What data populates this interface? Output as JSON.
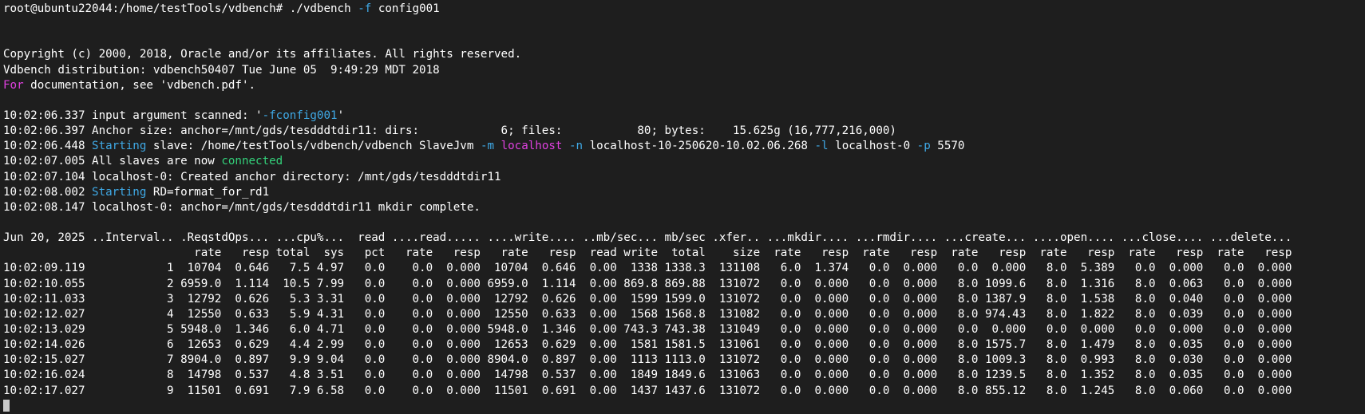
{
  "prompt": {
    "userhost": "root@ubuntu22044",
    "path": ":/home/testTools/vdbench",
    "symbol": "# ",
    "command": "./vdbench",
    "flag": "-f",
    "arg": "config001"
  },
  "banner": {
    "copyright": "Copyright (c) 2000, 2018, Oracle and/or its affiliates. All rights reserved.",
    "distribution": "Vdbench distribution: vdbench50407 Tue June 05  9:49:29 MDT 2018",
    "doc_for": "For",
    "doc_rest": " documentation, see 'vdbench.pdf'."
  },
  "log": {
    "l1_time": "10:02:06.337",
    "l1_text": " input argument scanned: '",
    "l1_arg": "-fconfig001",
    "l1_end": "'",
    "l2": "10:02:06.397 Anchor size: anchor=/mnt/gds/tesdddtdir11: dirs:            6; files:           80; bytes:    15.625g (16,777,216,000)",
    "l3_time": "10:02:06.448 ",
    "l3_starting": "Starting",
    "l3_a": " slave: /home/testTools/vdbench/vdbench SlaveJvm ",
    "l3_m": "-m",
    "l3_sp1": " ",
    "l3_localhost": "localhost",
    "l3_sp2": " ",
    "l3_n": "-n",
    "l3_b": " localhost-10-250620-10.02.06.268 ",
    "l3_l": "-l",
    "l3_c": " localhost-0 ",
    "l3_p": "-p",
    "l3_d": " 5570",
    "l4_text": "10:02:07.005 All slaves are now ",
    "l4_connected": "connected",
    "l5": "10:02:07.104 localhost-0: Created anchor directory: /mnt/gds/tesdddtdir11",
    "l6_time": "10:02:08.002 ",
    "l6_starting": "Starting",
    "l6_rest": " RD=format_for_rd1",
    "l7": "10:02:08.147 localhost-0: anchor=/mnt/gds/tesdddtdir11 mkdir complete."
  },
  "table": {
    "header1": "Jun 20, 2025 ..Interval.. .ReqstdOps... ...cpu%...  read ....read..... ....write.... ..mb/sec... mb/sec .xfer.. ...mkdir.... ...rmdir.... ...create... ....open.... ...close.... ...delete...",
    "header2": "                            rate   resp total  sys   pct   rate   resp   rate   resp  read write  total    size  rate   resp  rate   resp  rate   resp  rate   resp  rate   resp  rate   resp",
    "rows": [
      "10:02:09.119            1  10704  0.646   7.5 4.97   0.0    0.0  0.000  10704  0.646  0.00  1338 1338.3  131108   6.0  1.374   0.0  0.000   0.0  0.000   8.0  5.389   0.0  0.000   0.0  0.000",
      "10:02:10.055            2 6959.0  1.114  10.5 7.99   0.0    0.0  0.000 6959.0  1.114  0.00 869.8 869.88  131072   0.0  0.000   0.0  0.000   8.0 1099.6   8.0  1.316   8.0  0.063   0.0  0.000",
      "10:02:11.033            3  12792  0.626   5.3 3.31   0.0    0.0  0.000  12792  0.626  0.00  1599 1599.0  131072   0.0  0.000   0.0  0.000   8.0 1387.9   8.0  1.538   8.0  0.040   0.0  0.000",
      "10:02:12.027            4  12550  0.633   5.9 4.31   0.0    0.0  0.000  12550  0.633  0.00  1568 1568.8  131082   0.0  0.000   0.0  0.000   8.0 974.43   8.0  1.822   8.0  0.039   0.0  0.000",
      "10:02:13.029            5 5948.0  1.346   6.0 4.71   0.0    0.0  0.000 5948.0  1.346  0.00 743.3 743.38  131049   0.0  0.000   0.0  0.000   0.0  0.000   0.0  0.000   0.0  0.000   0.0  0.000",
      "10:02:14.026            6  12653  0.629   4.4 2.99   0.0    0.0  0.000  12653  0.629  0.00  1581 1581.5  131061   0.0  0.000   0.0  0.000   8.0 1575.7   8.0  1.479   8.0  0.035   0.0  0.000",
      "10:02:15.027            7 8904.0  0.897   9.9 9.04   0.0    0.0  0.000 8904.0  0.897  0.00  1113 1113.0  131072   0.0  0.000   0.0  0.000   8.0 1009.3   8.0  0.993   8.0  0.030   0.0  0.000",
      "10:02:16.024            8  14798  0.537   4.8 3.51   0.0    0.0  0.000  14798  0.537  0.00  1849 1849.6  131063   0.0  0.000   0.0  0.000   8.0 1239.5   8.0  1.352   8.0  0.035   0.0  0.000",
      "10:02:17.027            9  11501  0.691   7.9 6.58   0.0    0.0  0.000  11501  0.691  0.00  1437 1437.6  131072   0.0  0.000   0.0  0.000   8.0 855.12   8.0  1.245   8.0  0.060   0.0  0.000"
    ]
  }
}
